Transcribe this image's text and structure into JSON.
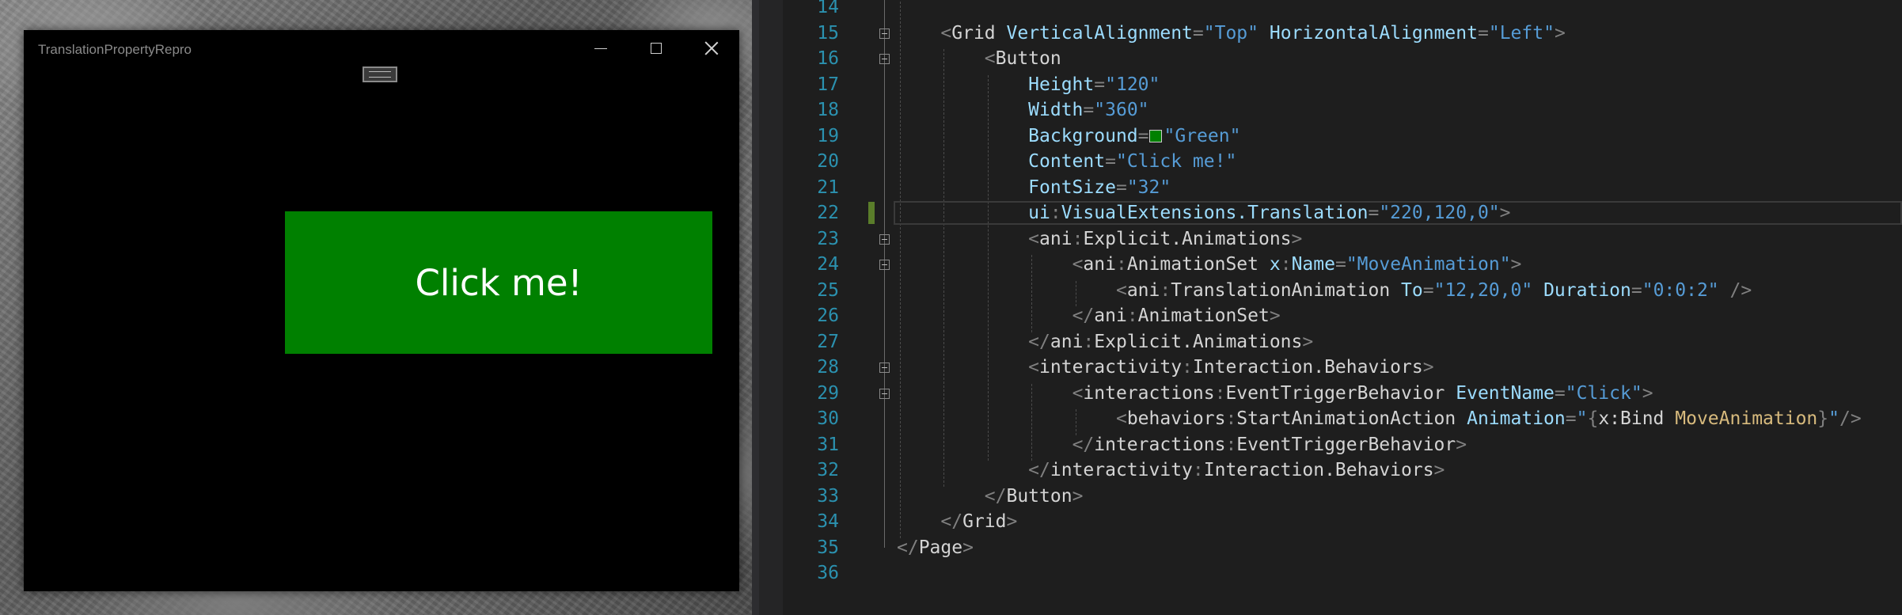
{
  "app_window": {
    "title": "TranslationPropertyRepro",
    "caption_buttons": {
      "minimize": "minimize-icon",
      "maximize": "maximize-icon",
      "close": "close-icon"
    },
    "button": {
      "content": "Click me!",
      "background": "#008000"
    }
  },
  "editor": {
    "line_numbers": [
      "14",
      "15",
      "16",
      "17",
      "18",
      "19",
      "20",
      "21",
      "22",
      "23",
      "24",
      "25",
      "26",
      "27",
      "28",
      "29",
      "30",
      "31",
      "32",
      "33",
      "34",
      "35",
      "36"
    ],
    "current_line": "22",
    "lines": [
      {
        "tokens": []
      },
      {
        "tokens": [
          [
            "    ",
            "t"
          ],
          [
            "<",
            "p"
          ],
          [
            "Grid",
            "e"
          ],
          [
            " ",
            "t"
          ],
          [
            "VerticalAlignment",
            "a"
          ],
          [
            "=",
            "p"
          ],
          [
            "\"Top\"",
            "v"
          ],
          [
            " ",
            "t"
          ],
          [
            "HorizontalAlignment",
            "a"
          ],
          [
            "=",
            "p"
          ],
          [
            "\"Left\"",
            "v"
          ],
          [
            ">",
            "p"
          ]
        ]
      },
      {
        "tokens": [
          [
            "        ",
            "t"
          ],
          [
            "<",
            "p"
          ],
          [
            "Button",
            "e"
          ]
        ]
      },
      {
        "tokens": [
          [
            "            ",
            "t"
          ],
          [
            "Height",
            "a"
          ],
          [
            "=",
            "p"
          ],
          [
            "\"120\"",
            "v"
          ]
        ]
      },
      {
        "tokens": [
          [
            "            ",
            "t"
          ],
          [
            "Width",
            "a"
          ],
          [
            "=",
            "p"
          ],
          [
            "\"360\"",
            "v"
          ]
        ]
      },
      {
        "tokens": [
          [
            "            ",
            "t"
          ],
          [
            "Background",
            "a"
          ],
          [
            "=",
            "p"
          ],
          [
            "SWATCH",
            "s"
          ],
          [
            "\"Green\"",
            "v"
          ]
        ]
      },
      {
        "tokens": [
          [
            "            ",
            "t"
          ],
          [
            "Content",
            "a"
          ],
          [
            "=",
            "p"
          ],
          [
            "\"Click me!\"",
            "v"
          ]
        ]
      },
      {
        "tokens": [
          [
            "            ",
            "t"
          ],
          [
            "FontSize",
            "a"
          ],
          [
            "=",
            "p"
          ],
          [
            "\"32\"",
            "v"
          ]
        ]
      },
      {
        "tokens": [
          [
            "            ",
            "t"
          ],
          [
            "ui",
            "a"
          ],
          [
            ":",
            "p"
          ],
          [
            "VisualExtensions.Translation",
            "a"
          ],
          [
            "=",
            "p"
          ],
          [
            "\"220,120,0\"",
            "v"
          ],
          [
            ">",
            "p"
          ]
        ]
      },
      {
        "tokens": [
          [
            "            ",
            "t"
          ],
          [
            "<",
            "p"
          ],
          [
            "ani",
            "e"
          ],
          [
            ":",
            "p"
          ],
          [
            "Explicit.Animations",
            "e"
          ],
          [
            ">",
            "p"
          ]
        ]
      },
      {
        "tokens": [
          [
            "                ",
            "t"
          ],
          [
            "<",
            "p"
          ],
          [
            "ani",
            "e"
          ],
          [
            ":",
            "p"
          ],
          [
            "AnimationSet",
            "e"
          ],
          [
            " ",
            "t"
          ],
          [
            "x",
            "a"
          ],
          [
            ":",
            "p"
          ],
          [
            "Name",
            "a"
          ],
          [
            "=",
            "p"
          ],
          [
            "\"MoveAnimation\"",
            "v"
          ],
          [
            ">",
            "p"
          ]
        ]
      },
      {
        "tokens": [
          [
            "                    ",
            "t"
          ],
          [
            "<",
            "p"
          ],
          [
            "ani",
            "e"
          ],
          [
            ":",
            "p"
          ],
          [
            "TranslationAnimation",
            "e"
          ],
          [
            " ",
            "t"
          ],
          [
            "To",
            "a"
          ],
          [
            "=",
            "p"
          ],
          [
            "\"12,20,0\"",
            "v"
          ],
          [
            " ",
            "t"
          ],
          [
            "Duration",
            "a"
          ],
          [
            "=",
            "p"
          ],
          [
            "\"0:0:2\"",
            "v"
          ],
          [
            " ",
            "t"
          ],
          [
            "/>",
            "p"
          ]
        ]
      },
      {
        "tokens": [
          [
            "                ",
            "t"
          ],
          [
            "</",
            "p"
          ],
          [
            "ani",
            "e"
          ],
          [
            ":",
            "p"
          ],
          [
            "AnimationSet",
            "e"
          ],
          [
            ">",
            "p"
          ]
        ]
      },
      {
        "tokens": [
          [
            "            ",
            "t"
          ],
          [
            "</",
            "p"
          ],
          [
            "ani",
            "e"
          ],
          [
            ":",
            "p"
          ],
          [
            "Explicit.Animations",
            "e"
          ],
          [
            ">",
            "p"
          ]
        ]
      },
      {
        "tokens": [
          [
            "            ",
            "t"
          ],
          [
            "<",
            "p"
          ],
          [
            "interactivity",
            "e"
          ],
          [
            ":",
            "p"
          ],
          [
            "Interaction.Behaviors",
            "e"
          ],
          [
            ">",
            "p"
          ]
        ]
      },
      {
        "tokens": [
          [
            "                ",
            "t"
          ],
          [
            "<",
            "p"
          ],
          [
            "interactions",
            "e"
          ],
          [
            ":",
            "p"
          ],
          [
            "EventTriggerBehavior",
            "e"
          ],
          [
            " ",
            "t"
          ],
          [
            "EventName",
            "a"
          ],
          [
            "=",
            "p"
          ],
          [
            "\"Click\"",
            "v"
          ],
          [
            ">",
            "p"
          ]
        ]
      },
      {
        "tokens": [
          [
            "                    ",
            "t"
          ],
          [
            "<",
            "p"
          ],
          [
            "behaviors",
            "e"
          ],
          [
            ":",
            "p"
          ],
          [
            "StartAnimationAction",
            "e"
          ],
          [
            " ",
            "t"
          ],
          [
            "Animation",
            "a"
          ],
          [
            "=",
            "p"
          ],
          [
            "\"",
            "v"
          ],
          [
            "{",
            "p"
          ],
          [
            "x:Bind",
            "k"
          ],
          [
            " ",
            "t"
          ],
          [
            "MoveAnimation",
            "b"
          ],
          [
            "}",
            "p"
          ],
          [
            "\"",
            "v"
          ],
          [
            "/>",
            "p"
          ]
        ]
      },
      {
        "tokens": [
          [
            "                ",
            "t"
          ],
          [
            "</",
            "p"
          ],
          [
            "interactions",
            "e"
          ],
          [
            ":",
            "p"
          ],
          [
            "EventTriggerBehavior",
            "e"
          ],
          [
            ">",
            "p"
          ]
        ]
      },
      {
        "tokens": [
          [
            "            ",
            "t"
          ],
          [
            "</",
            "p"
          ],
          [
            "interactivity",
            "e"
          ],
          [
            ":",
            "p"
          ],
          [
            "Interaction.Behaviors",
            "e"
          ],
          [
            ">",
            "p"
          ]
        ]
      },
      {
        "tokens": [
          [
            "        ",
            "t"
          ],
          [
            "</",
            "p"
          ],
          [
            "Button",
            "e"
          ],
          [
            ">",
            "p"
          ]
        ]
      },
      {
        "tokens": [
          [
            "    ",
            "t"
          ],
          [
            "</",
            "p"
          ],
          [
            "Grid",
            "e"
          ],
          [
            ">",
            "p"
          ]
        ]
      },
      {
        "tokens": [
          [
            "",
            "t"
          ],
          [
            "</",
            "p"
          ],
          [
            "Page",
            "e"
          ],
          [
            ">",
            "p"
          ]
        ]
      },
      {
        "tokens": []
      }
    ],
    "fold_markers": [
      "15",
      "16",
      "23",
      "24",
      "28",
      "29"
    ]
  }
}
